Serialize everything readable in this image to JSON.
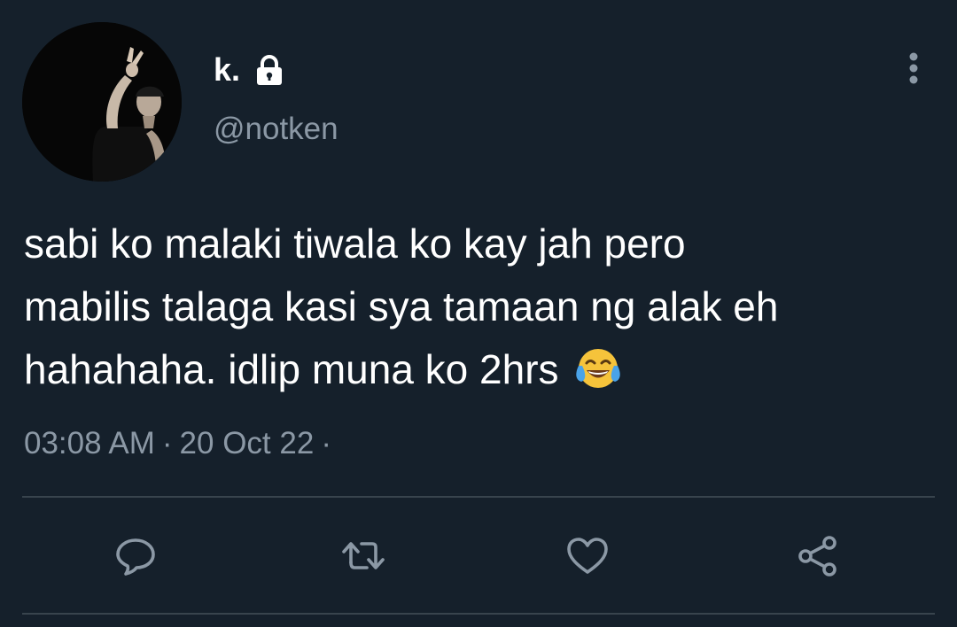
{
  "tweet": {
    "author": {
      "display_name": "k.",
      "handle": "@notken",
      "protected_icon": "lock-icon",
      "avatar": "profile-photo"
    },
    "text_lines": [
      "sabi ko malaki tiwala ko kay jah pero",
      "mabilis talaga kasi sya tamaan ng alak eh",
      "hahahaha. idlip muna ko 2hrs"
    ],
    "text_emoji": "face-with-tears-of-joy",
    "time": "03:08 AM",
    "date": "20 Oct 22",
    "separator": "·",
    "trailing_separator": "·"
  },
  "actions": [
    {
      "name": "reply",
      "icon": "reply-icon"
    },
    {
      "name": "retweet",
      "icon": "retweet-icon"
    },
    {
      "name": "like",
      "icon": "heart-icon"
    },
    {
      "name": "share",
      "icon": "share-icon"
    }
  ],
  "menu": {
    "icon": "more-vertical-icon"
  },
  "colors": {
    "background": "#15202b",
    "primary_text": "#ffffff",
    "secondary_text": "#8b98a5",
    "divider": "#38444d",
    "icon": "#8b98a5"
  }
}
